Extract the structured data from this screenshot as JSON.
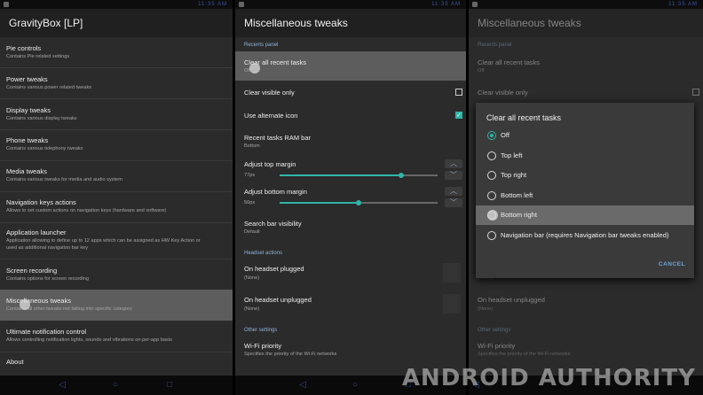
{
  "panel1": {
    "title": "GravityBox [LP]",
    "items": [
      {
        "title": "Pie controls",
        "sub": "Contains Pie related settings"
      },
      {
        "title": "Power tweaks",
        "sub": "Contains various power related tweaks"
      },
      {
        "title": "Display tweaks",
        "sub": "Contains various display tweaks"
      },
      {
        "title": "Phone tweaks",
        "sub": "Contains various telephony tweaks"
      },
      {
        "title": "Media tweaks",
        "sub": "Contains various tweaks for media and audio system"
      },
      {
        "title": "Navigation keys actions",
        "sub": "Allows to set custom actions on navigation keys (hardware and software)"
      },
      {
        "title": "Application launcher",
        "sub": "Application allowing to define up to 12 apps which can be assigned as HW Key Action or",
        "sub2": "used as additional navigation bar key"
      },
      {
        "title": "Screen recording",
        "sub": "Contains options for screen recording"
      },
      {
        "title": "Miscellaneous tweaks",
        "sub": "Contains all other tweaks not falling into specific category"
      },
      {
        "title": "Ultimate notification control",
        "sub": "Allows controlling notification lights, sounds and vibrations on per-app basis"
      },
      {
        "title": "About",
        "sub": ""
      }
    ]
  },
  "panel2": {
    "title": "Miscellaneous tweaks",
    "cat_recents": "Recents panel",
    "clear_all": "Clear all recent tasks",
    "clear_all_value": "Off",
    "clear_visible": "Clear visible only",
    "alt_icon": "Use alternate icon",
    "ram_bar": "Recent tasks RAM bar",
    "ram_bar_value": "Bottom",
    "top_margin": "Adjust top margin",
    "top_margin_value": "77px",
    "top_margin_level": 0.77,
    "bottom_margin": "Adjust bottom margin",
    "bottom_margin_value": "50px",
    "bottom_margin_level": 0.5,
    "search_bar": "Search bar visibility",
    "search_bar_value": "Default",
    "cat_headset": "Headset actions",
    "plugged": "On headset plugged",
    "plugged_value": "(None)",
    "unplugged": "On headset unplugged",
    "unplugged_value": "(None)",
    "cat_other": "Other settings",
    "wifi": "Wi-Fi priority",
    "wifi_value": "Specifies the priority of the Wi-Fi networks"
  },
  "panel3": {
    "title": "Miscellaneous tweaks",
    "dialog_title": "Clear all recent tasks",
    "options": [
      "Off",
      "Top left",
      "Top right",
      "Bottom left",
      "Bottom right",
      "Navigation bar (requires Navigation bar tweaks enabled)"
    ],
    "selected": "Off",
    "cancel": "CANCEL",
    "behind_cat": "Recents panel",
    "behind_clear": "Clear all recent tasks",
    "behind_off": "Off",
    "behind_visible": "Clear visible only",
    "behind_none": "(None)",
    "behind_unplugged": "On headset unplugged",
    "behind_none2": "(None)",
    "behind_other": "Other settings",
    "behind_wifi": "Wi-Fi priority",
    "behind_wifi_sub": "Specifies the priority of the Wi-Fi networks"
  },
  "statusbar": {
    "time": "11:35 AM"
  },
  "watermark": "ANDROID AUTHORITY",
  "colors": {
    "accent": "#2fb6a9",
    "highlight": "#5d5d5d",
    "category": "#8fb5d9"
  }
}
